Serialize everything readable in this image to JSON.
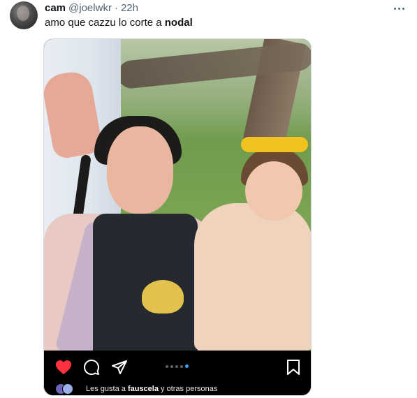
{
  "author": {
    "display_name": "cam",
    "handle": "@joelwkr",
    "separator": "·",
    "time": "22h",
    "avatar_icon": "profile-photo"
  },
  "menu": {
    "icon": "more-horizontal-icon"
  },
  "tweet": {
    "text_plain": "amo que cazzu lo corte a ",
    "text_bold": "nodal"
  },
  "media": {
    "pager": {
      "count": 5,
      "active_index": 4
    },
    "likes": {
      "prefix": "Les gusta a ",
      "user": "fauscela",
      "suffix": " y otras personas"
    },
    "icons": [
      "heart-icon",
      "comment-icon",
      "share-icon",
      "bookmark-icon"
    ],
    "colors": {
      "heart": "#ff3040",
      "pager_active": "#3b9bff",
      "bar_bg": "#000000"
    }
  }
}
